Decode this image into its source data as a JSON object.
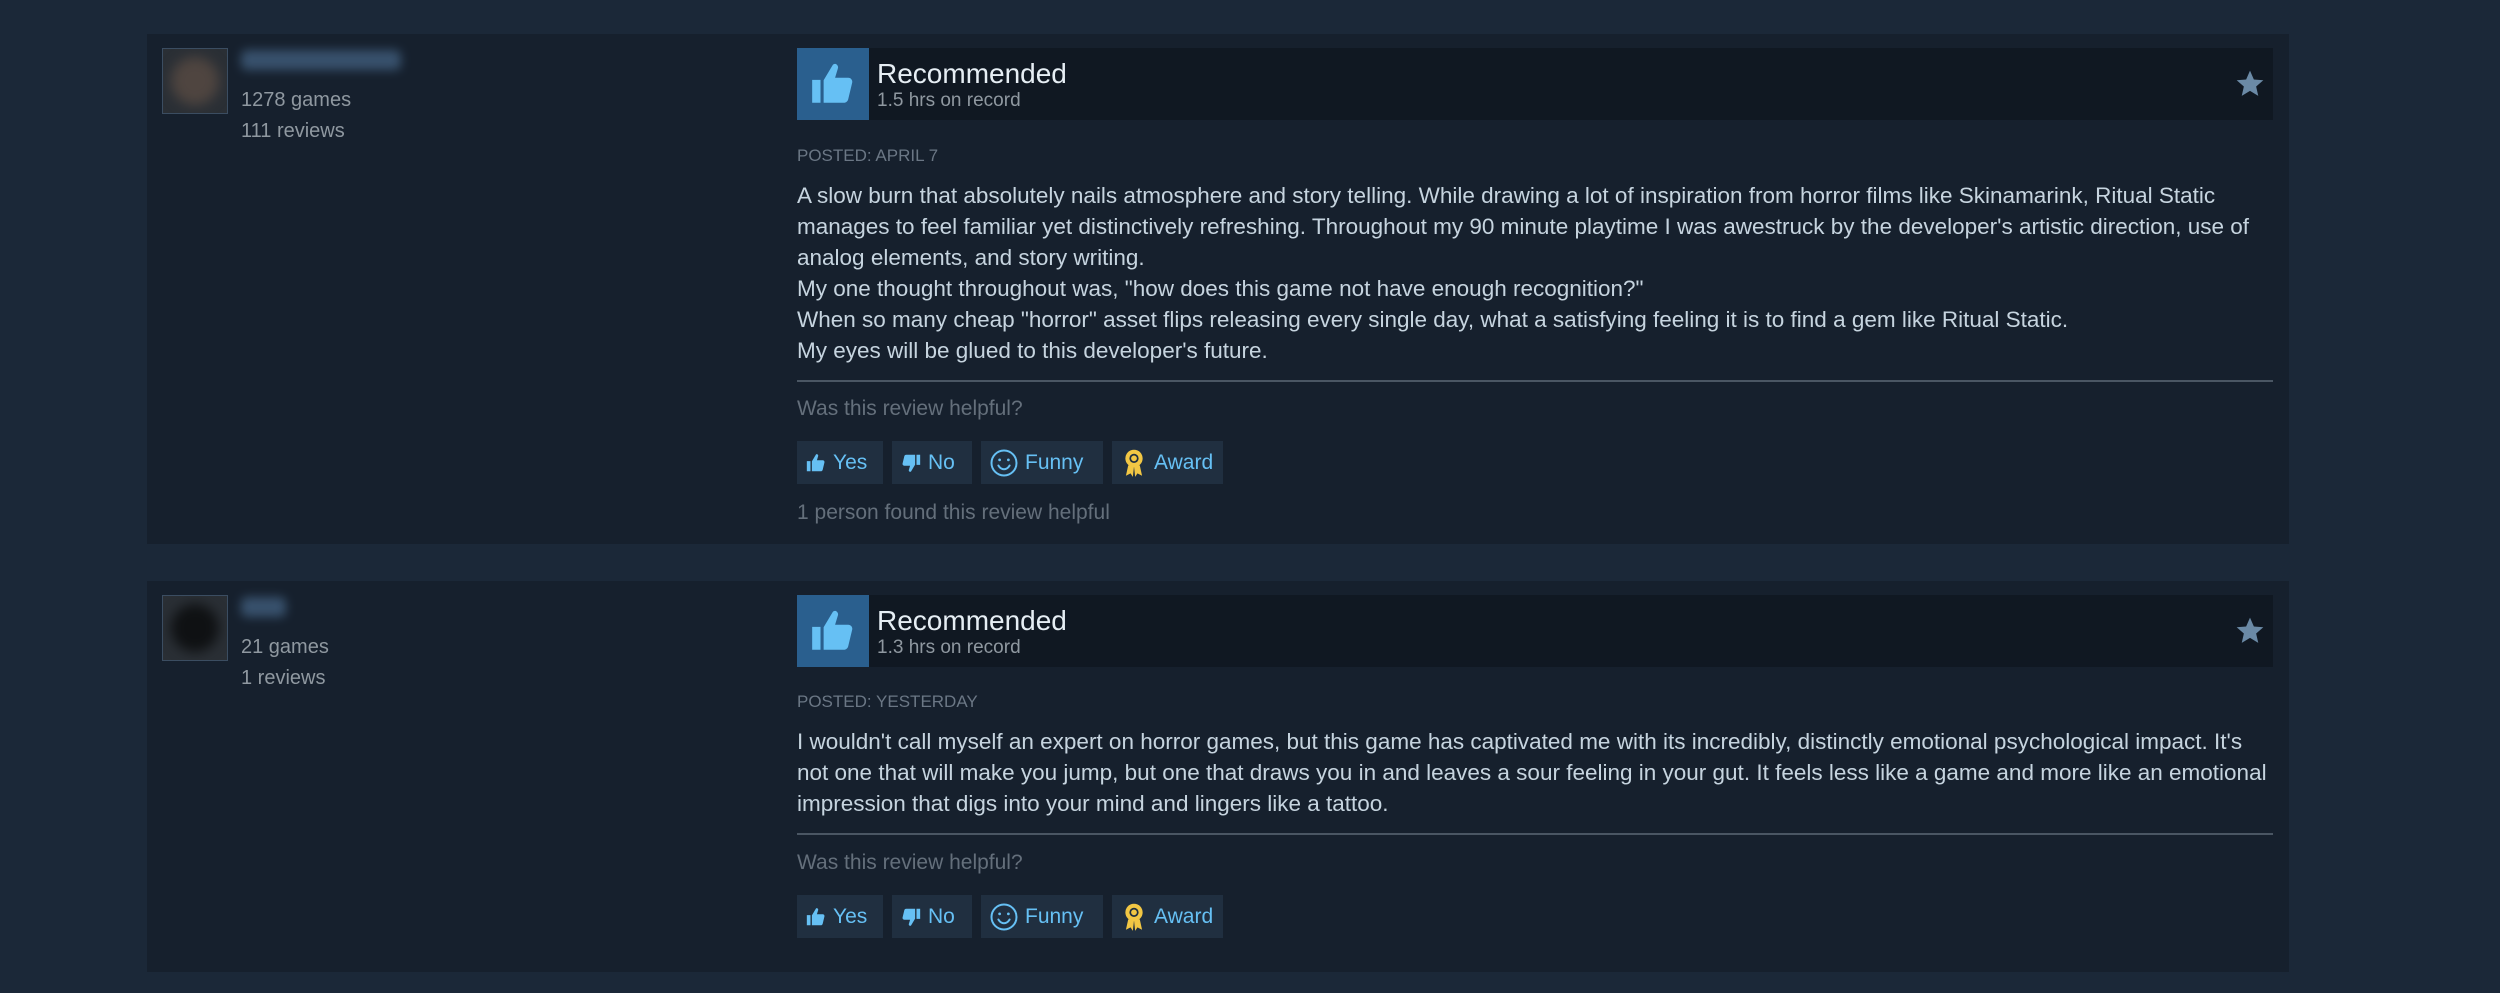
{
  "reviews": [
    {
      "author": {
        "games": "1278 games",
        "reviews": "111 reviews"
      },
      "vote": "Recommended",
      "hours": "1.5 hrs on record",
      "posted": "POSTED: APRIL 7",
      "content": [
        "A slow burn that absolutely nails atmosphere and story telling. While drawing a lot of inspiration from horror films like Skinamarink, Ritual Static manages to feel familiar yet distinctively refreshing. Throughout my 90 minute playtime I was awestruck by the developer's artistic direction, use of analog elements, and story writing.",
        "My one thought throughout was, \"how does this game not have enough recognition?\"",
        "When so many cheap \"horror\" asset flips releasing every single day, what a satisfying feeling it is to find a gem like Ritual Static.",
        "My eyes will be glued to this developer's future."
      ],
      "helpful_question": "Was this review helpful?",
      "buttons": {
        "yes": "Yes",
        "no": "No",
        "funny": "Funny",
        "award": "Award"
      },
      "found_helpful": "1 person found this review helpful"
    },
    {
      "author": {
        "games": "21 games",
        "reviews": "1 reviews"
      },
      "vote": "Recommended",
      "hours": "1.3 hrs on record",
      "posted": "POSTED: YESTERDAY",
      "content": [
        "I wouldn't call myself an expert on horror games, but this game has captivated me with its incredibly, distinctly emotional psychological impact. It's not one that will make you jump, but one that draws you in and leaves a sour feeling in your gut. It feels less like a game and more like an emotional impression that digs into your mind and lingers like a tattoo."
      ],
      "helpful_question": "Was this review helpful?",
      "buttons": {
        "yes": "Yes",
        "no": "No",
        "funny": "Funny",
        "award": "Award"
      }
    }
  ],
  "icons": {
    "thumbs_up": "thumbs-up-icon",
    "thumbs_down": "thumbs-down-icon",
    "smiley": "smiley-icon",
    "award": "award-icon",
    "star": "star-icon"
  },
  "colors": {
    "background": "#1b2838",
    "panel": "#16202d",
    "accent_blue": "#66c0f4",
    "thumb_box": "#2a5f8e",
    "award_gold": "#f2c744"
  }
}
